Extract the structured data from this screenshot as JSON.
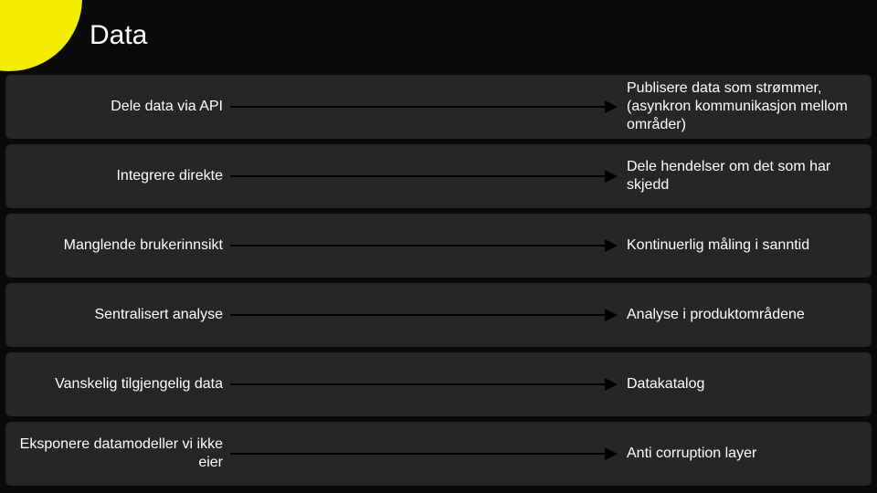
{
  "title": "Data",
  "rows": [
    {
      "left": "Dele data via API",
      "right": "Publisere data som strømmer, (asynkron kommunikasjon mellom områder)"
    },
    {
      "left": "Integrere direkte",
      "right": "Dele hendelser om det som har skjedd"
    },
    {
      "left": "Manglende brukerinnsikt",
      "right": "Kontinuerlig måling i sanntid"
    },
    {
      "left": "Sentralisert analyse",
      "right": "Analyse i produktområdene"
    },
    {
      "left": "Vanskelig tilgjengelig data",
      "right": "Datakatalog"
    },
    {
      "left": "Eksponere datamodeller vi ikke eier",
      "right": "Anti corruption layer"
    }
  ]
}
